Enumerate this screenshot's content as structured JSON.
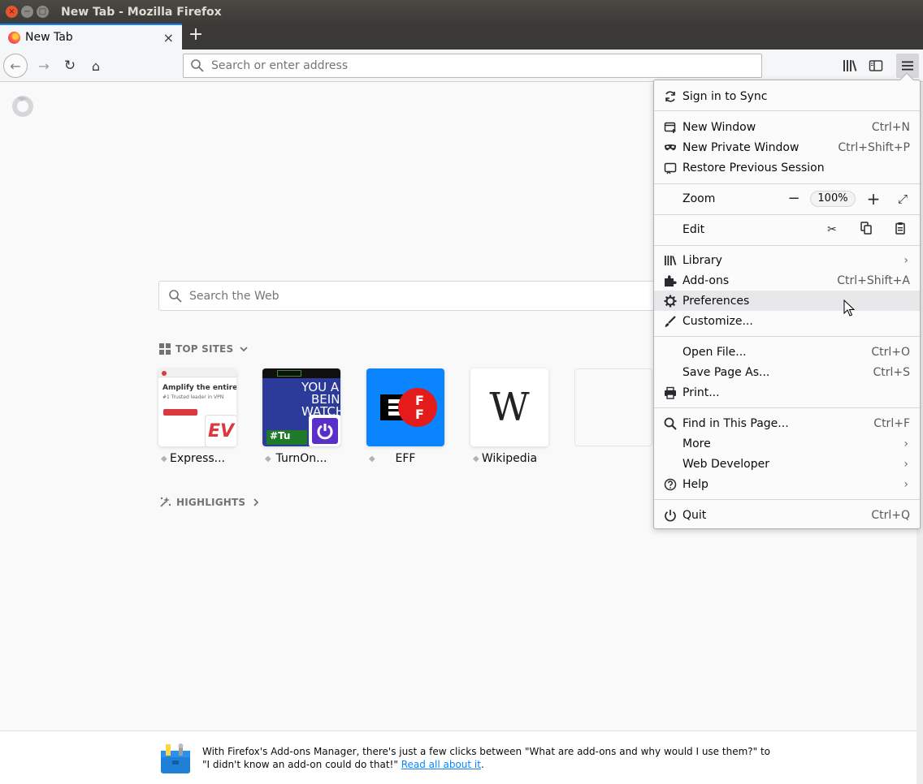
{
  "window": {
    "title": "New Tab - Mozilla Firefox",
    "close": "×",
    "minimize": "−",
    "maximize": "□"
  },
  "tabs": [
    {
      "label": "New Tab",
      "close": "×",
      "favicon": "firefox-icon"
    }
  ],
  "new_tab_symbol": "+",
  "navbar": {
    "url_placeholder": "Search or enter address",
    "back_icon": "←",
    "forward_icon": "→",
    "reload_icon": "↻",
    "home_icon": "⌂"
  },
  "newtab_page": {
    "search_placeholder": "Search the Web",
    "top_sites_title": "TOP SITES",
    "highlights_title": "HIGHLIGHTS",
    "top_sites": [
      {
        "label": "Express...",
        "tile_heading": "Amplify the entire Inter",
        "tile_sub": "#1 Trusted leader in VPN",
        "overlay": "EV"
      },
      {
        "label": "TurnOn...",
        "tile_text_1": "YOU A",
        "tile_text_2": "BEIN",
        "tile_text_3": "WATCH",
        "tile_hash": "#Tu"
      },
      {
        "label": "EFF",
        "tile_letter": "E",
        "tile_letters_right": "F F"
      },
      {
        "label": "Wikipedia",
        "tile_letter": "W"
      }
    ]
  },
  "snippet": {
    "text": "With Firefox's Add-ons Manager, there's just a few clicks between \"What are add-ons and why would I use them?\" to \"I didn't know an add-on could do that!\"",
    "link_text": "Read all about it",
    "trailing": "."
  },
  "menu": {
    "sign_in": "Sign in to Sync",
    "new_window": {
      "label": "New Window",
      "shortcut": "Ctrl+N"
    },
    "new_private_window": {
      "label": "New Private Window",
      "shortcut": "Ctrl+Shift+P"
    },
    "restore_session": {
      "label": "Restore Previous Session"
    },
    "zoom": {
      "label": "Zoom",
      "minus": "−",
      "value": "100%",
      "plus": "+",
      "fullscreen": "⤢"
    },
    "edit": {
      "label": "Edit",
      "cut": "✂",
      "copy": "⎘",
      "paste": "📋"
    },
    "library": {
      "label": "Library",
      "arrow": "›"
    },
    "addons": {
      "label": "Add-ons",
      "shortcut": "Ctrl+Shift+A"
    },
    "preferences": {
      "label": "Preferences"
    },
    "customize": {
      "label": "Customize..."
    },
    "open_file": {
      "label": "Open File...",
      "shortcut": "Ctrl+O"
    },
    "save_page": {
      "label": "Save Page As...",
      "shortcut": "Ctrl+S"
    },
    "print": {
      "label": "Print..."
    },
    "find": {
      "label": "Find in This Page...",
      "shortcut": "Ctrl+F"
    },
    "more": {
      "label": "More",
      "arrow": "›"
    },
    "web_developer": {
      "label": "Web Developer",
      "arrow": "›"
    },
    "help": {
      "label": "Help",
      "arrow": "›"
    },
    "quit": {
      "label": "Quit",
      "shortcut": "Ctrl+Q"
    }
  },
  "colors": {
    "accent": "#0a84ff",
    "title_bar": "#3c3b37",
    "close_button": "#e9542f",
    "menu_hover": "#e8e8ea"
  }
}
